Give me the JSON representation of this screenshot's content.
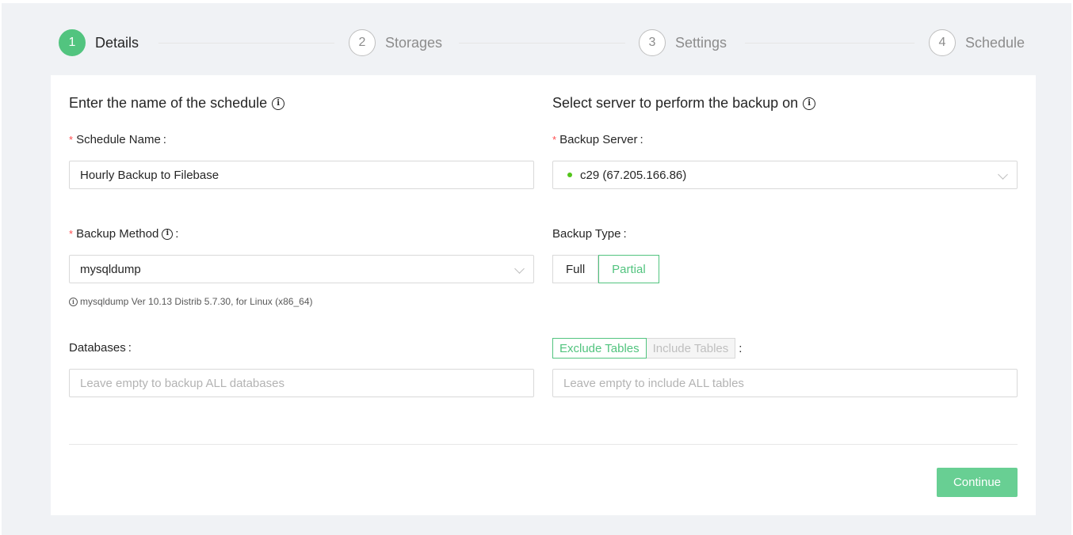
{
  "steps": [
    {
      "number": "1",
      "title": "Details"
    },
    {
      "number": "2",
      "title": "Storages"
    },
    {
      "number": "3",
      "title": "Settings"
    },
    {
      "number": "4",
      "title": "Schedule"
    }
  ],
  "details": {
    "name_section_title": "Enter the name of the schedule",
    "server_section_title": "Select server to perform the backup on",
    "schedule_name": {
      "label": "Schedule Name",
      "value": "Hourly Backup to Filebase"
    },
    "backup_server": {
      "label": "Backup Server",
      "value": "c29 (67.205.166.86)",
      "status_color": "#52c41a"
    },
    "backup_method": {
      "label": "Backup Method",
      "value": "mysqldump",
      "hint": "mysqldump Ver 10.13 Distrib 5.7.30, for Linux (x86_64)"
    },
    "backup_type": {
      "label": "Backup Type",
      "options": [
        "Full",
        "Partial"
      ],
      "selected": "Partial"
    },
    "databases": {
      "label": "Databases",
      "placeholder": "Leave empty to backup ALL databases"
    },
    "tables": {
      "mode_options": [
        "Exclude Tables",
        "Include Tables"
      ],
      "selected_mode": "Exclude Tables",
      "placeholder": "Leave empty to include ALL tables"
    },
    "continue_label": "Continue"
  },
  "colors": {
    "accent": "#52c47f",
    "required": "#ff4d4f"
  }
}
